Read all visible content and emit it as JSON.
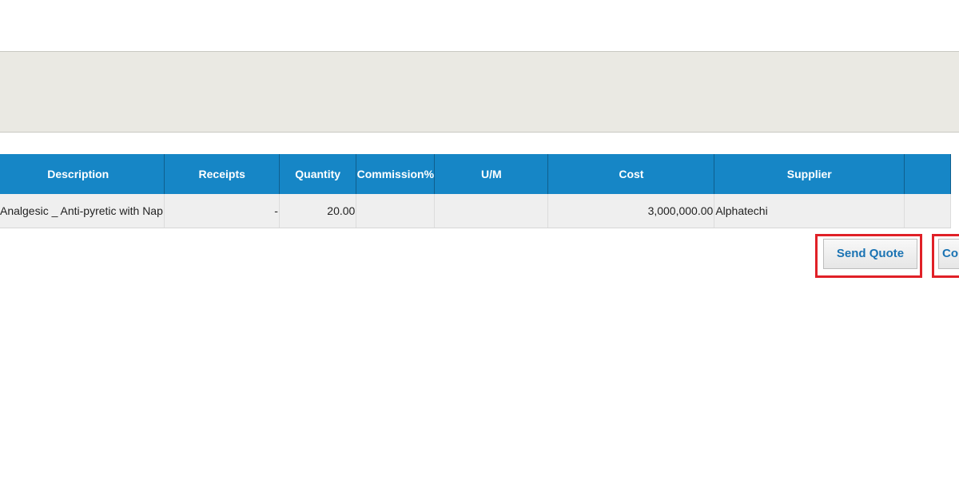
{
  "table": {
    "columns": [
      "Description",
      "Receipts",
      "Quantity",
      "Commission%",
      "U/M",
      "Cost",
      "Supplier",
      ""
    ],
    "rows": [
      {
        "description": "Analgesic _ Anti-pyretic with Nap",
        "receipts": "-",
        "quantity": "20.00",
        "commission": "",
        "um": "",
        "cost": "3,000,000.00",
        "supplier": "Alphatechi",
        "extra": ""
      }
    ]
  },
  "actions": {
    "send_quote_label": "Send Quote",
    "second_label": "Co"
  },
  "colors": {
    "header_bg": "#1686c6",
    "highlight": "#e02027",
    "button_text": "#1a73b3",
    "panel_bg": "#eae9e3"
  }
}
